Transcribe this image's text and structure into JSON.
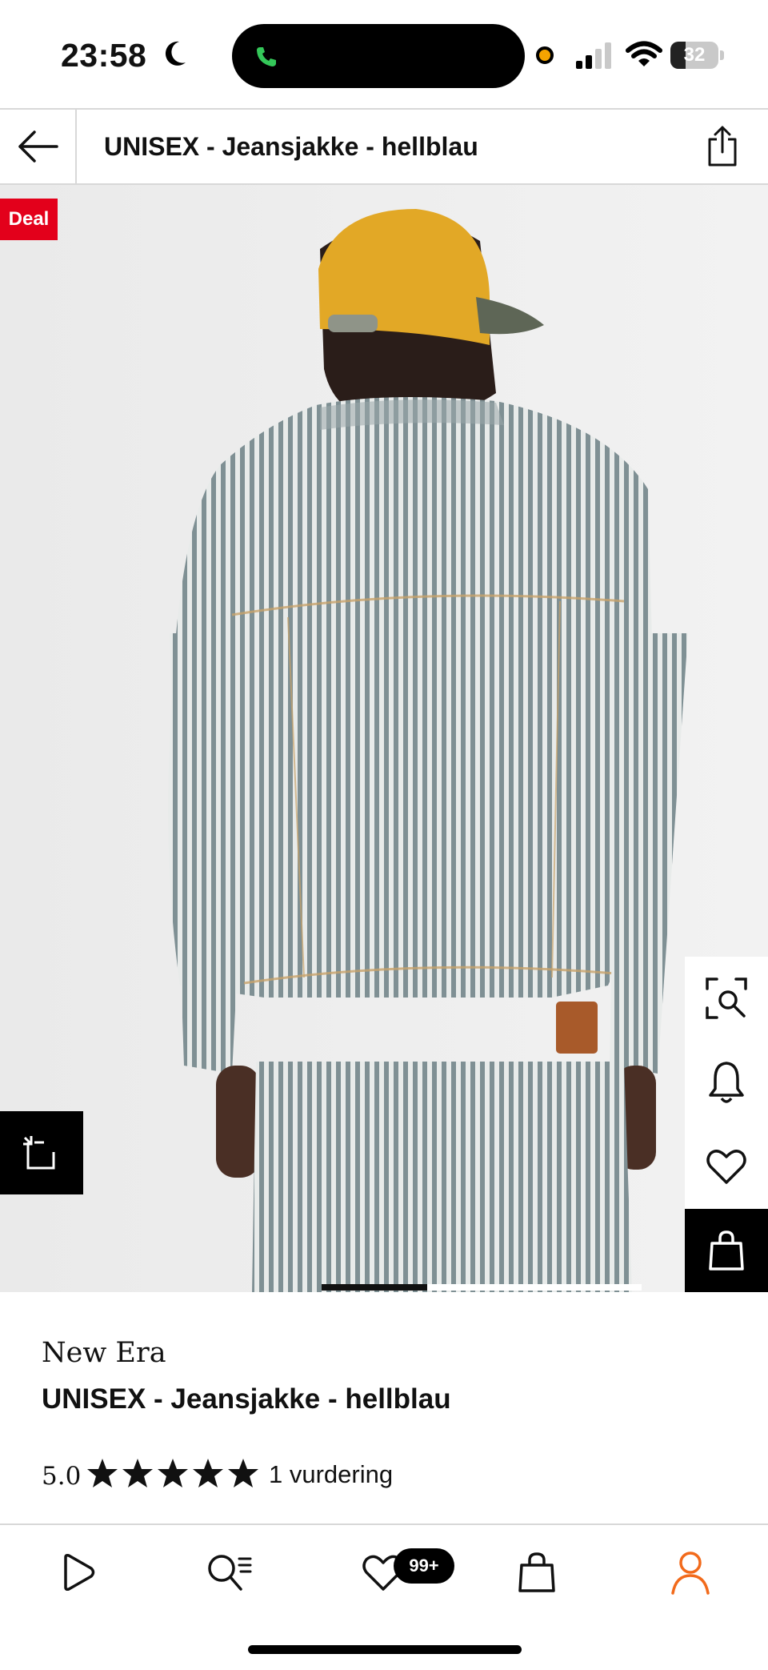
{
  "status_bar": {
    "time": "23:58",
    "battery_level": "32",
    "battery_fraction": 0.32,
    "icons": [
      "moon-icon",
      "phone-icon",
      "recording-dot-icon",
      "signal-icon",
      "wifi-icon",
      "battery-icon"
    ]
  },
  "header": {
    "title": "UNISEX - Jeansjakke - hellblau",
    "back_icon": "arrow-left-icon",
    "share_icon": "share-icon"
  },
  "product_image": {
    "deal_badge": "Deal",
    "actions": [
      "visual-search-icon",
      "bell-icon",
      "heart-icon",
      "bag-icon"
    ],
    "fit_icon": "size-fit-icon",
    "gallery_active_fraction": 0.33
  },
  "product": {
    "brand": "New Era",
    "name": "UNISEX - Jeansjakke - hellblau",
    "rating": "5.0",
    "stars": 5,
    "review_count": "1 vurdering"
  },
  "bottom_nav": {
    "items": [
      "play-icon",
      "search-icon",
      "heart-icon",
      "bag-icon",
      "user-icon"
    ],
    "wishlist_badge": "99+",
    "accent": "#f26a1b"
  },
  "colors": {
    "deal_red": "#e3001b",
    "accent_orange": "#f26a1b",
    "cap_yellow": "#e2a826"
  }
}
